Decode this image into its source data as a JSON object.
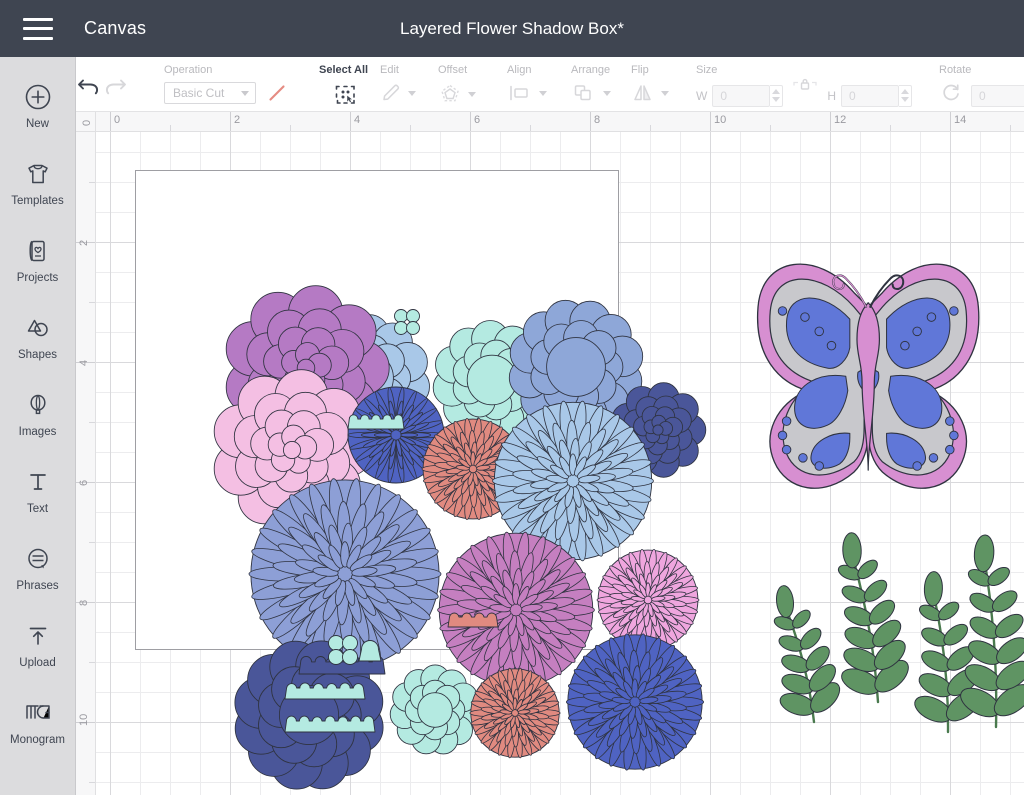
{
  "topbar": {
    "menu_icon": "hamburger-icon",
    "canvas_label": "Canvas",
    "doc_title": "Layered Flower Shadow Box*"
  },
  "sidebar": {
    "items": [
      {
        "icon": "plus-circle-icon",
        "label": "New"
      },
      {
        "icon": "tshirt-icon",
        "label": "Templates"
      },
      {
        "icon": "card-heart-icon",
        "label": "Projects"
      },
      {
        "icon": "shapes-icon",
        "label": "Shapes"
      },
      {
        "icon": "balloon-icon",
        "label": "Images"
      },
      {
        "icon": "text-t-icon",
        "label": "Text"
      },
      {
        "icon": "speech-bubble-icon",
        "label": "Phrases"
      },
      {
        "icon": "upload-arrow-icon",
        "label": "Upload"
      },
      {
        "icon": "monogram-icon",
        "label": "Monogram"
      }
    ]
  },
  "toolbar": {
    "undo_icon": "undo-arrow-icon",
    "redo_icon": "redo-arrow-icon",
    "operation": {
      "label": "Operation",
      "value": "Basic Cut",
      "swatch_icon": "pen-line-icon"
    },
    "select_all": {
      "label": "Select All",
      "icon": "select-all-icon"
    },
    "edit": {
      "label": "Edit",
      "icon": "pencil-icon"
    },
    "offset": {
      "label": "Offset",
      "icon": "offset-polygon-icon"
    },
    "align": {
      "label": "Align",
      "icon": "align-left-icon"
    },
    "arrange": {
      "label": "Arrange",
      "icon": "arrange-layers-icon"
    },
    "flip": {
      "label": "Flip",
      "icon": "flip-horizontal-icon"
    },
    "size": {
      "label": "Size",
      "lock_icon": "lock-icon",
      "w_label": "W",
      "w_value": "0",
      "h_label": "H",
      "h_value": "0"
    },
    "rotate": {
      "label": "Rotate",
      "icon": "rotate-icon",
      "value": "0"
    }
  },
  "rulers": {
    "unit_marks_h": [
      "0",
      "2",
      "4",
      "6",
      "8",
      "10",
      "12",
      "14"
    ],
    "unit_marks_v": [
      "0",
      "2",
      "4",
      "6",
      "8",
      "10"
    ],
    "corner_label": "0"
  },
  "canvas": {
    "mat_label": "design-mat",
    "palette": {
      "orchid": "#b57ac4",
      "light_pink": "#f4bfe3",
      "pale_blue": "#a9c8e8",
      "mint": "#b4eae1",
      "periwinkle": "#8d9fd6",
      "royal_blue": "#4f63c2",
      "navy": "#4a5699",
      "coral": "#e08a80",
      "pink": "#efa6de",
      "mauve": "#c57fc0",
      "steel_blue": "#8ea7d8",
      "green_leaf": "#5f9463",
      "butterfly_pink": "#d78fd1",
      "butterfly_grey": "#c8c8cc",
      "butterfly_blue": "#6077d8",
      "stroke": "#2f3340"
    }
  }
}
